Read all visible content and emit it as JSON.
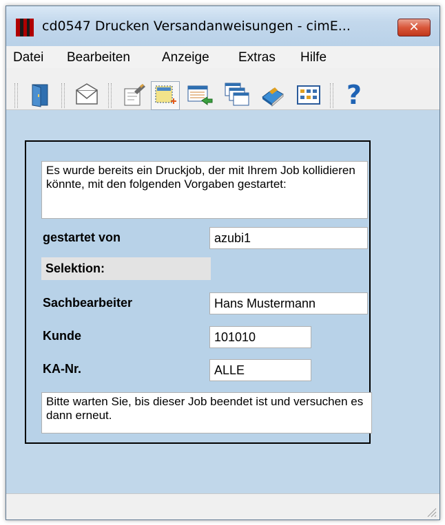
{
  "window": {
    "title": "cd0547 Drucken Versandanweisungen - cimE...",
    "close_label": "✕"
  },
  "menu": {
    "items": [
      "Datei",
      "Bearbeiten",
      "Anzeige",
      "Extras",
      "Hilfe"
    ]
  },
  "toolbar": {
    "icons": [
      "exit-door-icon",
      "envelope-icon",
      "edit-document-icon",
      "select-area-icon",
      "import-list-icon",
      "windows-cascade-icon",
      "book-icon",
      "grid-view-icon",
      "help-icon"
    ],
    "active_icon": "select-area-icon",
    "help_glyph": "?"
  },
  "dialog": {
    "intro": "Es wurde bereits ein Druckjob, der mit Ihrem Job kollidieren könnte, mit den folgenden Vorgaben gestartet:",
    "started_by_label": "gestartet von",
    "started_by_value": "azubi1",
    "selection_label": "Selektion:",
    "clerk_label": "Sachbearbeiter",
    "clerk_value": "Hans Mustermann",
    "customer_label": "Kunde",
    "customer_value": "101010",
    "ka_label": "KA-Nr.",
    "ka_value": "ALLE",
    "footer": "Bitte warten Sie, bis dieser Job beendet ist und versuchen es dann erneut."
  },
  "colors": {
    "client_bg": "#c1d7ea",
    "close_button": "#c0381c"
  }
}
